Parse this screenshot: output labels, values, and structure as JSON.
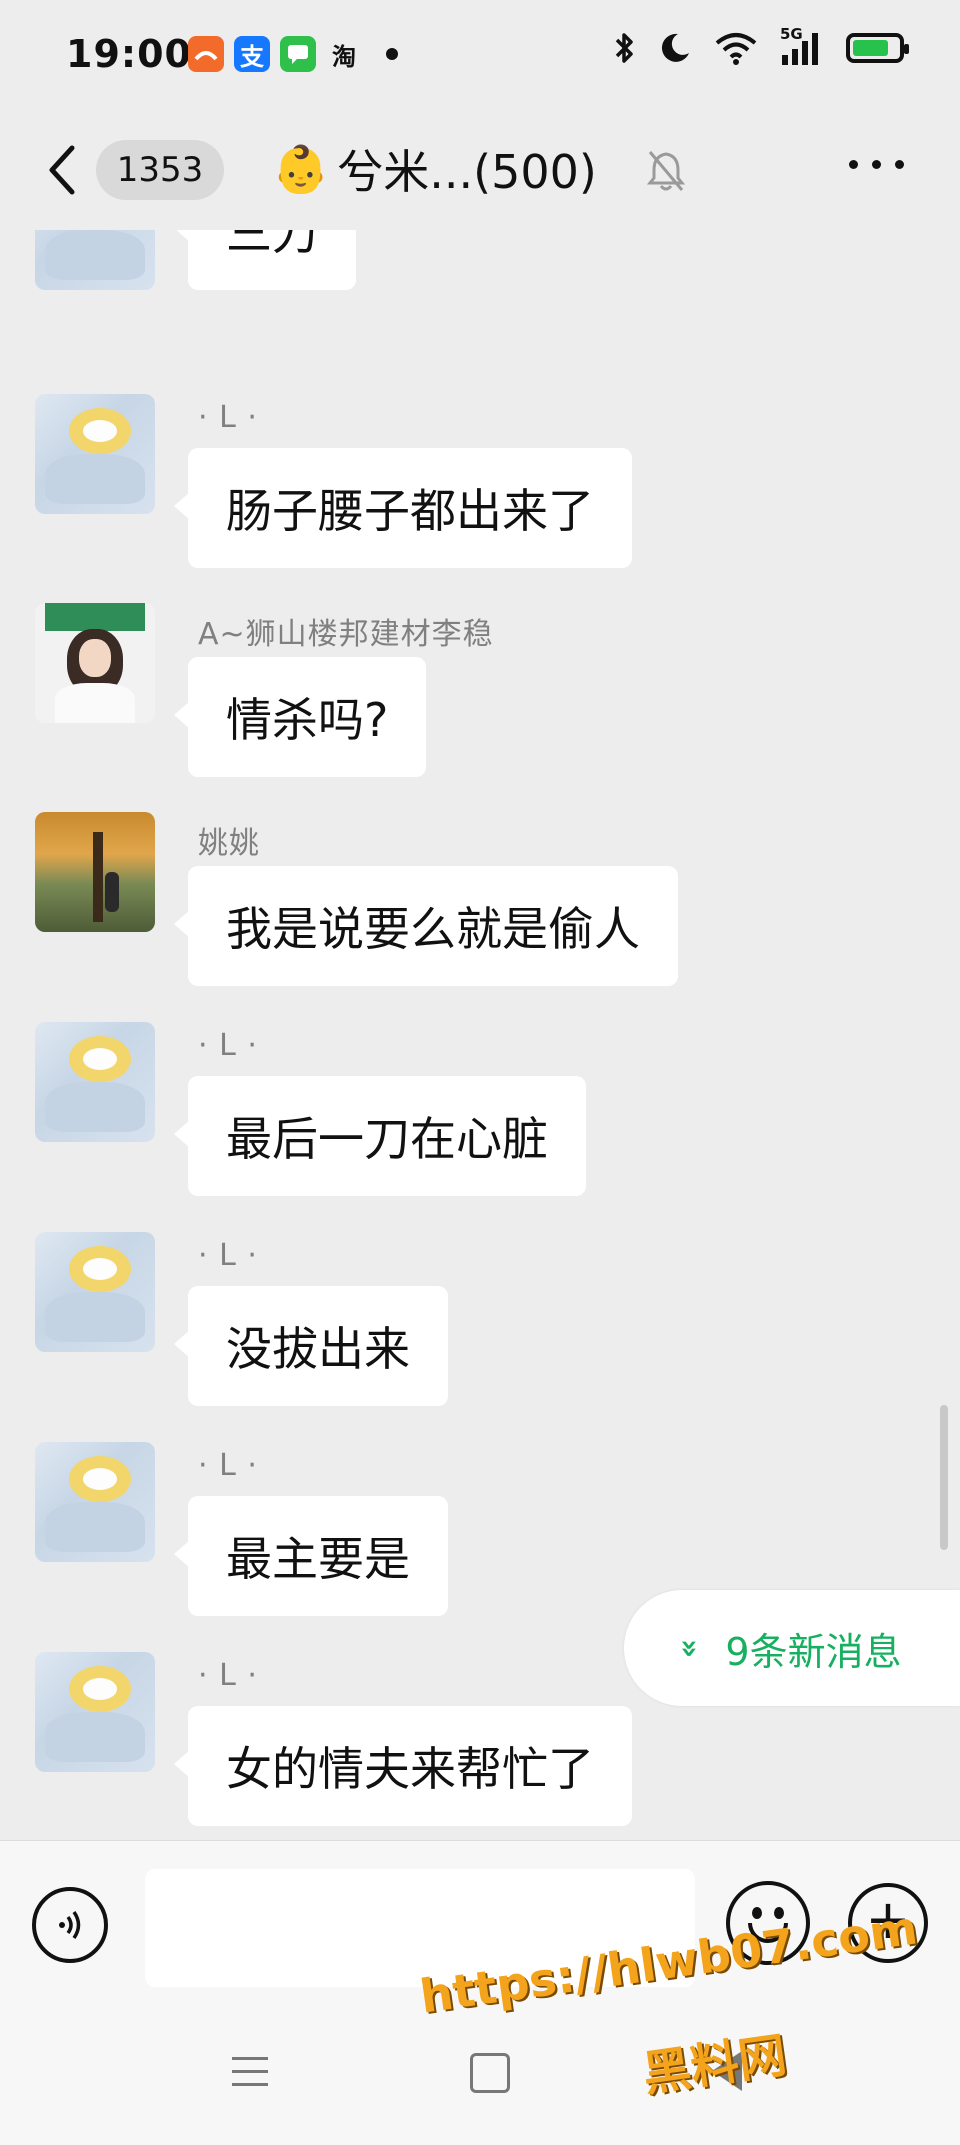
{
  "status_bar": {
    "time": "19:00",
    "apps": [
      {
        "icon": "aliexpress-icon",
        "label": "",
        "color": "#f26b2a"
      },
      {
        "icon": "alipay-icon",
        "label": "支",
        "color": "#1677ff"
      },
      {
        "icon": "messages-icon",
        "label": "",
        "color": "#2fbf4b"
      },
      {
        "icon": "taobao-icon",
        "label": "淘",
        "color": "#111111"
      }
    ],
    "network": "5G",
    "battery_level": 0.8
  },
  "header": {
    "unread_count": "1353",
    "title_emoji": "👶",
    "title": "兮米...(500)"
  },
  "messages": [
    {
      "sender": "",
      "text": "三刀",
      "avatar": "plush"
    },
    {
      "sender": "· L ·",
      "text": "肠子腰子都出来了",
      "avatar": "plush"
    },
    {
      "sender": "A~狮山楼邦建材李稳",
      "text": "情杀吗?",
      "avatar": "girl"
    },
    {
      "sender": "姚姚",
      "text": "我是说要么就是偷人",
      "avatar": "tree"
    },
    {
      "sender": "· L ·",
      "text": "最后一刀在心脏",
      "avatar": "plush"
    },
    {
      "sender": "· L ·",
      "text": "没拔出来",
      "avatar": "plush"
    },
    {
      "sender": "· L ·",
      "text": "最主要是",
      "avatar": "plush"
    },
    {
      "sender": "· L ·",
      "text": "女的情夫来帮忙了",
      "avatar": "plush"
    }
  ],
  "new_messages": {
    "text": "9条新消息",
    "chevron": "»",
    "color": "#17b060"
  },
  "input": {
    "value": "",
    "placeholder": ""
  },
  "watermark": {
    "line1": "https://hlwb07.com",
    "line2": "黑料网"
  }
}
